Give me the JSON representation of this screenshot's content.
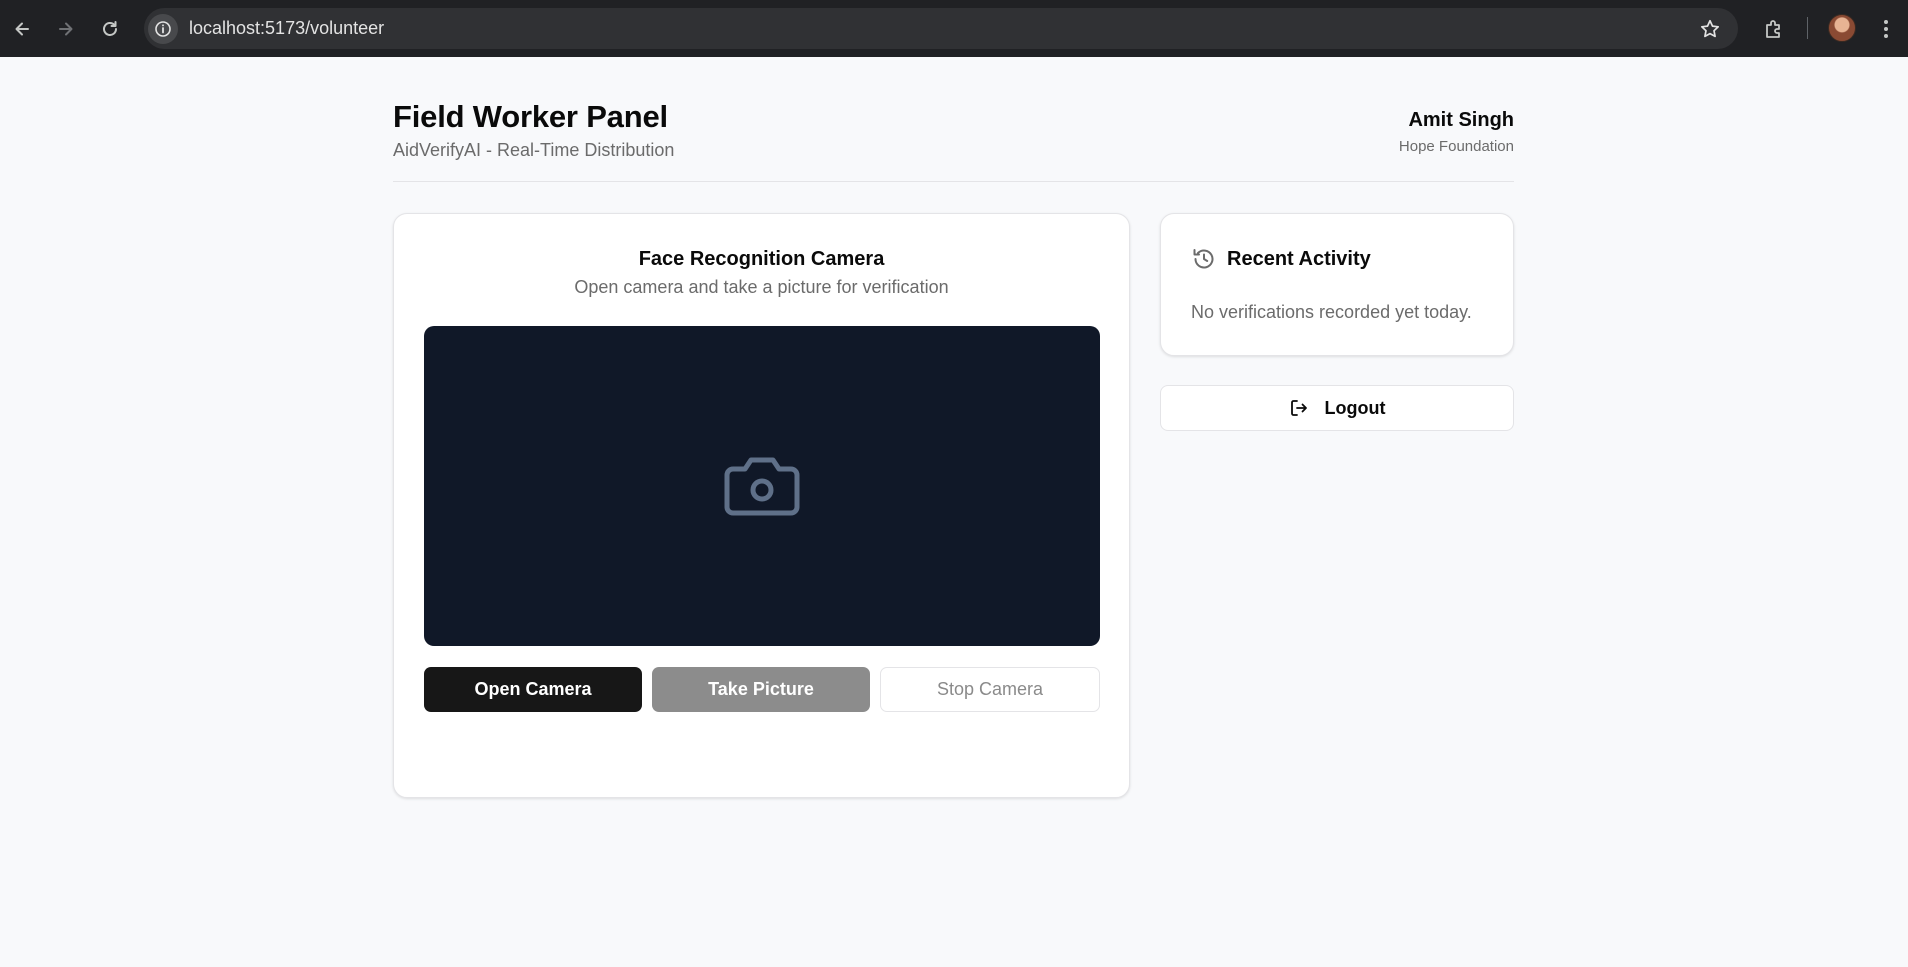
{
  "browser": {
    "url": "localhost:5173/volunteer",
    "icons": [
      "back-icon",
      "forward-icon",
      "reload-icon",
      "site-info-icon",
      "bookmark-star-icon",
      "extensions-icon",
      "profile-avatar",
      "menu-kebab-icon"
    ]
  },
  "header": {
    "title": "Field Worker Panel",
    "subtitle": "AidVerifyAI - Real-Time Distribution",
    "user_name": "Amit Singh",
    "user_org": "Hope Foundation"
  },
  "camera": {
    "title": "Face Recognition Camera",
    "description": "Open camera and take a picture for verification",
    "placeholder_icon": "camera-icon",
    "buttons": {
      "open": "Open Camera",
      "take": "Take Picture",
      "stop": "Stop Camera"
    }
  },
  "activity": {
    "icon": "history-icon",
    "title": "Recent Activity",
    "empty_message": "No verifications recorded yet today."
  },
  "logout": {
    "icon": "logout-icon",
    "label": "Logout"
  },
  "colors": {
    "camera_bg": "#101828",
    "primary_button": "#171717",
    "disabled_button": "#8c8c8c",
    "page_bg": "#f8f9fb"
  }
}
